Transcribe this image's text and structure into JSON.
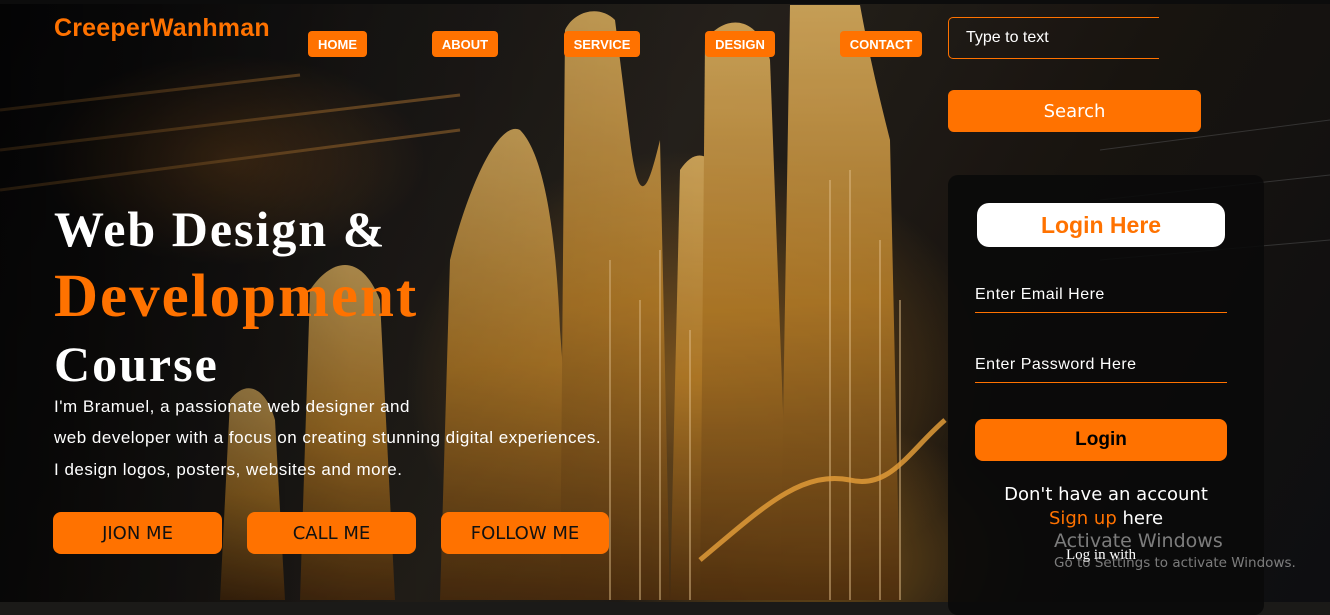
{
  "header": {
    "brand": "CreeperWanhman",
    "nav": [
      "HOME",
      "ABOUT",
      "SERVICE",
      "DESIGN",
      "CONTACT"
    ],
    "search_placeholder": "Type to text",
    "search_button": "Search"
  },
  "hero": {
    "line1": "Web Design &",
    "line2": "Development",
    "line3": "Course",
    "paragraph": [
      "I'm Bramuel, a passionate web designer and",
      "web developer with a focus on creating stunning digital experiences.",
      "I design logos, posters, websites and more."
    ],
    "buttons": [
      "JION ME",
      "CALL ME",
      "FOLLOW ME"
    ]
  },
  "login": {
    "title": "Login Here",
    "email_placeholder": "Enter Email Here",
    "password_placeholder": "Enter Password Here",
    "button": "Login",
    "no_account": "Don't have an account",
    "signup_link": "Sign up",
    "signup_suffix": " here",
    "login_with": "Log in with"
  },
  "watermark": {
    "title": "Activate Windows",
    "subtitle": "Go to Settings to activate Windows."
  },
  "colors": {
    "accent": "#ff7200",
    "card_bg": "#0a0a0a",
    "text": "#ffffff"
  }
}
